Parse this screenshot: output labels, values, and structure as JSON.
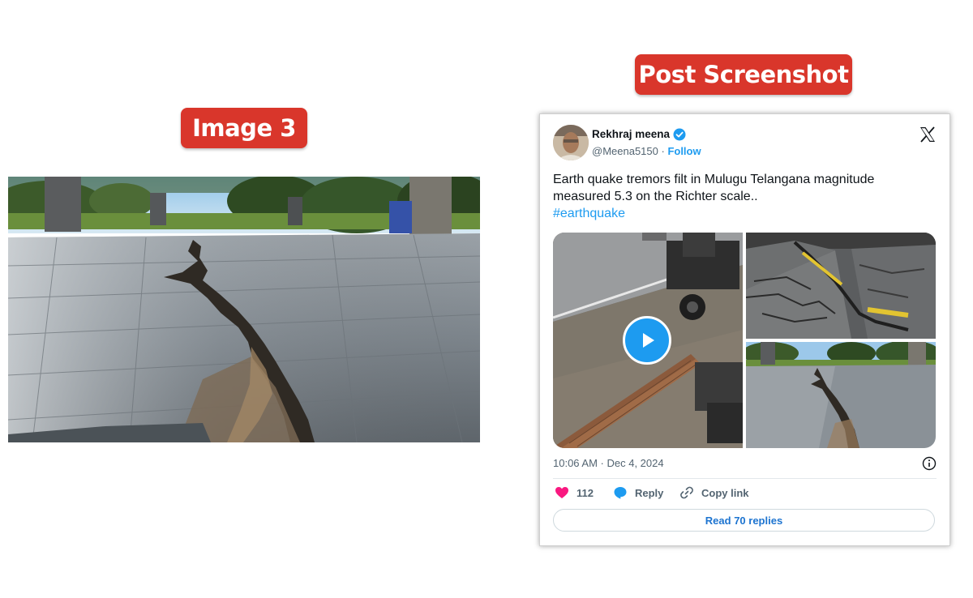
{
  "labels": {
    "image_label": "Image 3",
    "post_label": "Post Screenshot"
  },
  "colors": {
    "label_red": "#d9362b",
    "twitter_blue": "#1d9bf0",
    "like_pink": "#f91880"
  },
  "tweet": {
    "user_name": "Rekhraj meena",
    "handle": "@Meena5150",
    "separator": " · ",
    "follow_label": "Follow",
    "text": "Earth quake tremors filt in Mulugu Telangana magnitude measured 5.3 on the Richter scale..",
    "hashtag": "#earthquake",
    "timestamp": "10:06 AM · Dec 4, 2024",
    "likes_count": "112",
    "reply_label": "Reply",
    "copy_link_label": "Copy link",
    "read_replies_label": "Read 70 replies"
  },
  "icons": [
    "verified-badge-icon",
    "x-logo-icon",
    "play-icon",
    "info-icon",
    "heart-icon",
    "reply-icon",
    "link-icon"
  ]
}
